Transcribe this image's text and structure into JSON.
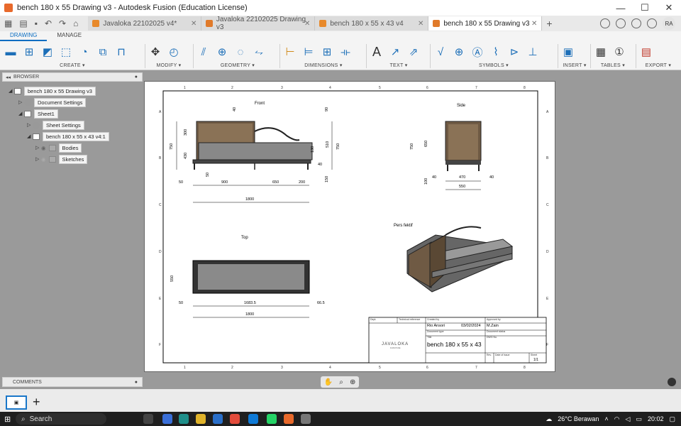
{
  "window": {
    "title": "bench 180 x 55  Drawing v3 - Autodesk Fusion (Education License)",
    "min": "—",
    "max": "☐",
    "close": "✕"
  },
  "tabs": [
    {
      "label": "Javaloka 22102025 v4*",
      "color": "#e8892b"
    },
    {
      "label": "Javaloka 22102025 Drawing v3",
      "color": "#e07a2a"
    },
    {
      "label": "bench 180 x 55 x 43 v4",
      "color": "#e8892b"
    },
    {
      "label": "bench 180 x 55  Drawing v3",
      "color": "#e07a2a"
    }
  ],
  "account": {
    "initials": "RA"
  },
  "ribbon": {
    "tabs": [
      "DRAWING",
      "MANAGE"
    ],
    "groups": [
      "CREATE ▾",
      "MODIFY ▾",
      "GEOMETRY ▾",
      "DIMENSIONS ▾",
      "TEXT ▾",
      "SYMBOLS ▾",
      "INSERT ▾",
      "TABLES ▾",
      "EXPORT ▾"
    ]
  },
  "browser": {
    "title": "BROWSER",
    "items": [
      "bench 180 x 55  Drawing v3",
      "Document Settings",
      "Sheet1",
      "Sheet Settings",
      "bench 180 x 55 x 43 v4:1",
      "Bodies",
      "Sketches"
    ]
  },
  "comments": {
    "title": "COMMENTS"
  },
  "drawing": {
    "views": {
      "front": "Front",
      "side": "Side",
      "top": "Top",
      "persp": "Pers fektif"
    },
    "grid_cols": [
      "1",
      "2",
      "3",
      "4",
      "5",
      "6",
      "7",
      "8"
    ],
    "grid_rows": [
      "A",
      "B",
      "C",
      "D",
      "E",
      "F"
    ],
    "front_dims": [
      "40",
      "90",
      "300",
      "750",
      "430",
      "130",
      "510",
      "750",
      "50",
      "40",
      "150",
      "50",
      "900",
      "650",
      "200",
      "1800"
    ],
    "side_dims": [
      "650",
      "750",
      "100",
      "40",
      "470",
      "40",
      "550"
    ],
    "top_dims": [
      "550",
      "50",
      "1683.5",
      "66.5",
      "1800"
    ],
    "title_block": {
      "dept": "Dept.",
      "tech_ref": "Technical reference",
      "created_by": "Created by",
      "approved_by": "Approved by",
      "creator": "Rio Ansori",
      "date": "03/02/2024",
      "approver": "M.Zain",
      "doc_type": "Document type",
      "doc_status": "Document status",
      "title_lbl": "Title",
      "dwg_no": "DWG No.",
      "title": "bench 180 x 55 x 43",
      "rev": "Rev.",
      "date_issue": "Date of issue",
      "sheet_lbl": "Sheet",
      "sheet": "1/1",
      "logo": "JAVALOKA",
      "logo_sub": "FURNITURE"
    }
  },
  "taskbar": {
    "search": "Search",
    "weather": "26°C  Berawan",
    "time": "20:02"
  }
}
